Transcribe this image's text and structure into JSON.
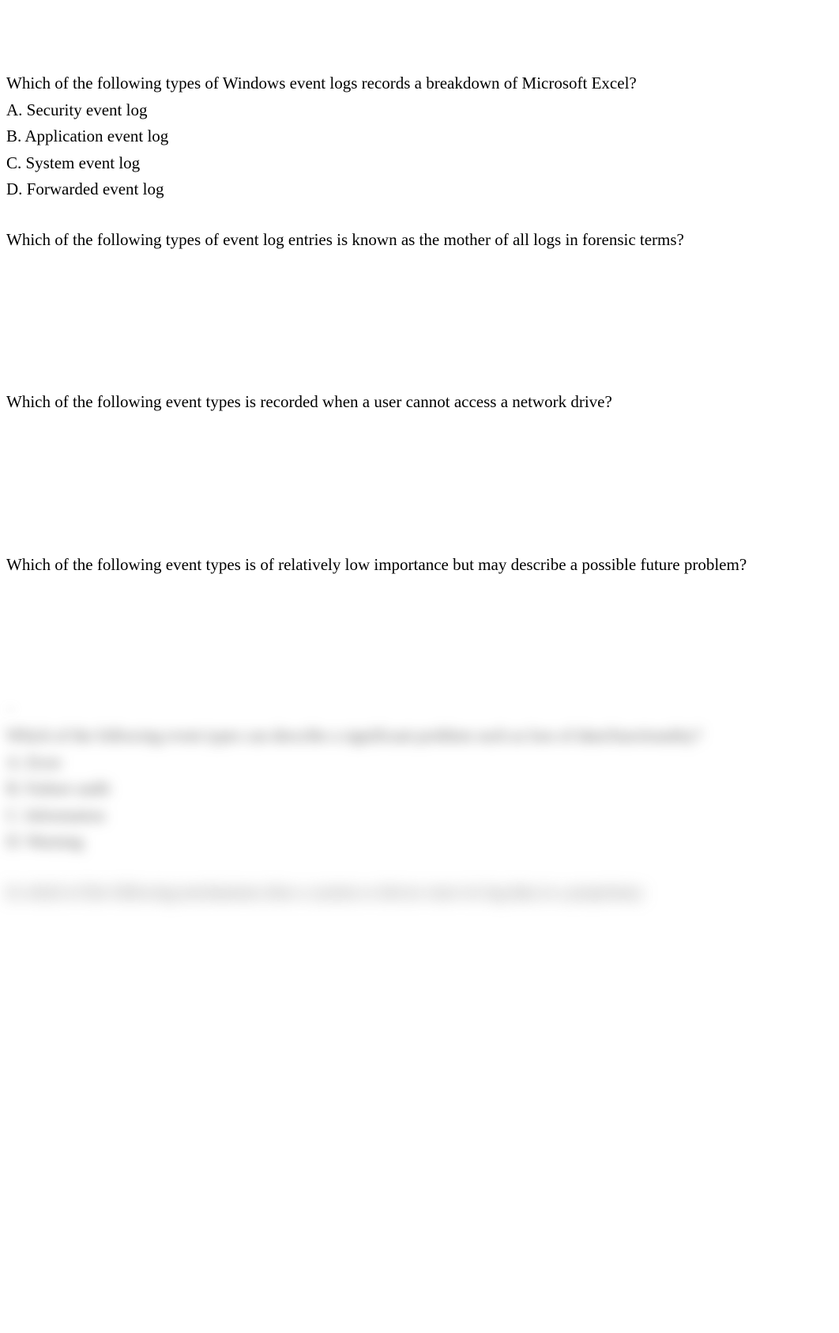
{
  "q1": {
    "text": "Which of the following types of Windows event logs records a breakdown of Microsoft Excel?",
    "options": {
      "a": "A. Security event log",
      "b": "B. Application event log",
      "c": "C. System event log",
      "d": "D. Forwarded event log"
    }
  },
  "q2": {
    "text": "Which of the following types of event log entries is known as the mother of all logs in forensic terms?"
  },
  "q3": {
    "text": "Which of the following event types is recorded when a user cannot access a network drive?"
  },
  "q4": {
    "text": "Which of the following event types is of relatively low importance but may describe a possible future problem?"
  },
  "q4_trail": "...",
  "q5": {
    "text": "Which of the following event types can describe a significant problem such as loss of data/functionality?",
    "options": {
      "a": "A. Error",
      "b": "B. Failure audit",
      "c": "C. Information",
      "d": "D. Warning"
    }
  },
  "q6": {
    "text": "In which of the following mechanisms does a system or device store its log data in a proprietary"
  }
}
